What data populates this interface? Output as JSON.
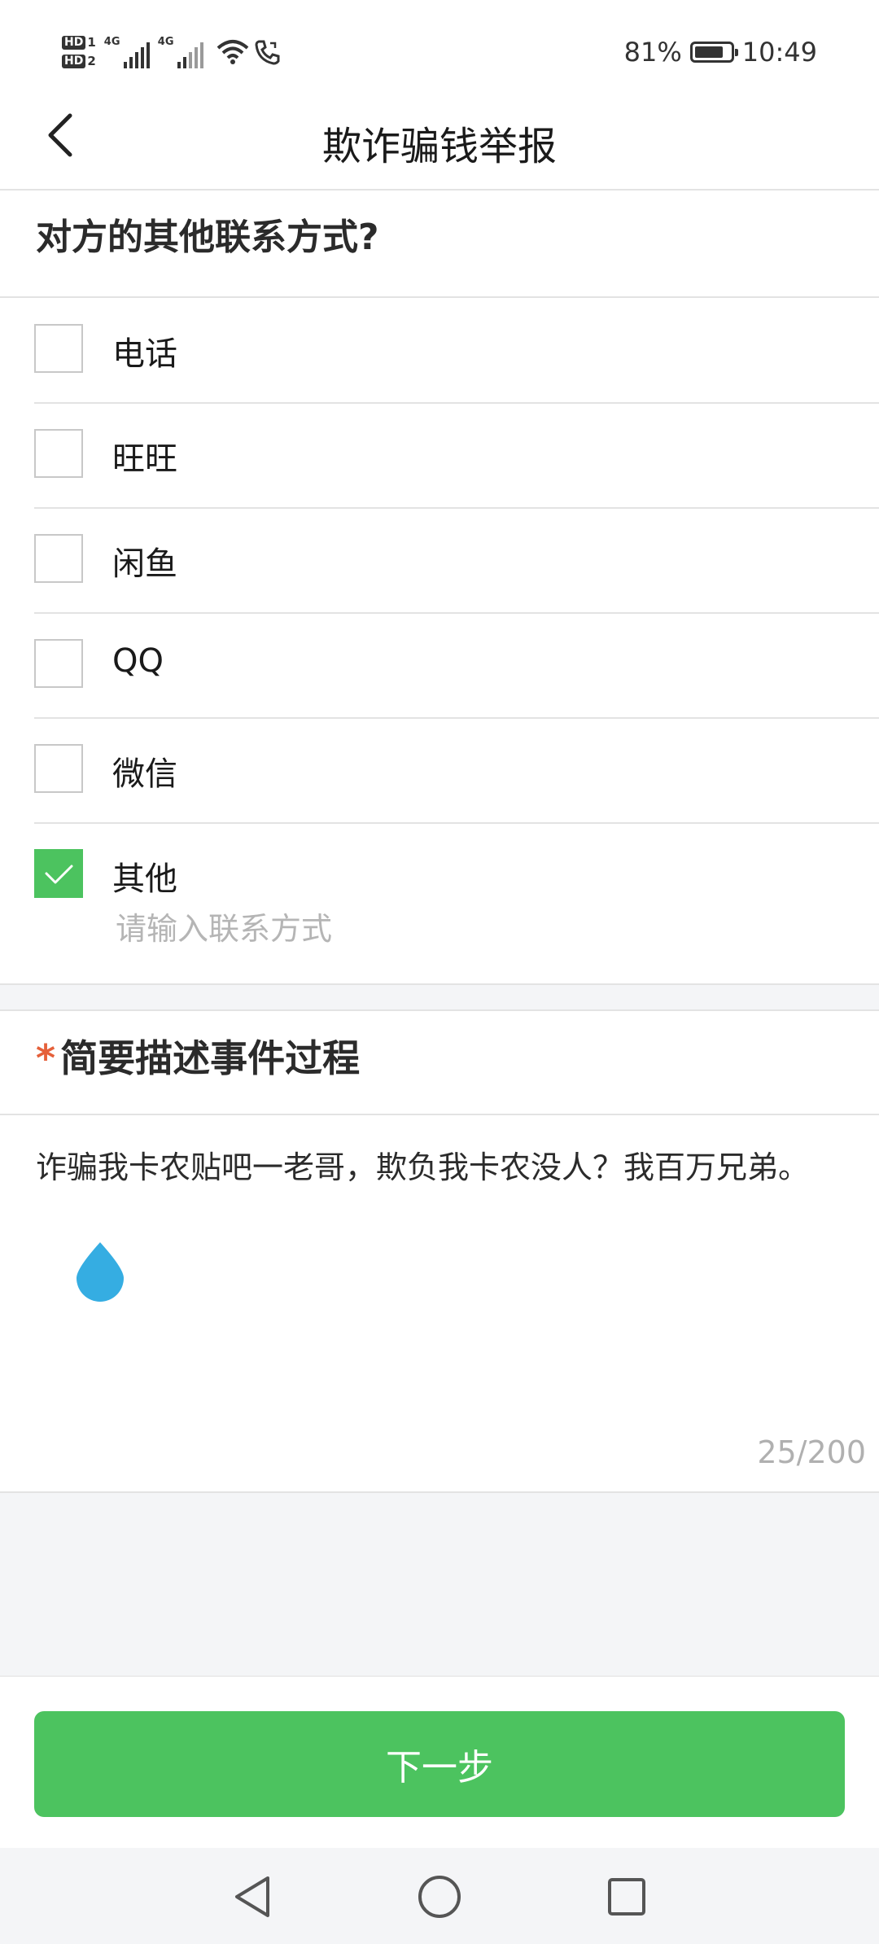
{
  "status_bar": {
    "hd1": "HD",
    "hd1_sub": "1",
    "hd2": "HD",
    "hd2_sub": "2",
    "net1": "4G",
    "net2": "4G",
    "battery_percent": "81%",
    "battery_level": 0.81,
    "time": "10:49",
    "icons": [
      "wifi-icon",
      "phone-call-icon",
      "battery-icon"
    ]
  },
  "nav": {
    "title": "欺诈骗钱举报",
    "back_icon": "chevron-left-icon"
  },
  "contact_question": {
    "title": "对方的其他联系方式?",
    "options": [
      {
        "label": "电话",
        "checked": false
      },
      {
        "label": "旺旺",
        "checked": false
      },
      {
        "label": "闲鱼",
        "checked": false
      },
      {
        "label": "QQ",
        "checked": false
      },
      {
        "label": "微信",
        "checked": false
      },
      {
        "label": "其他",
        "checked": true
      }
    ],
    "other_placeholder": "请输入联系方式"
  },
  "description": {
    "required_mark": "*",
    "title": "简要描述事件过程",
    "text": "诈骗我卡农贴吧一老哥，欺负我卡农没人？我百万兄弟。",
    "counter": "25/200"
  },
  "footer": {
    "next_label": "下一步"
  },
  "colors": {
    "accent_green": "#4cc35f",
    "required_red": "#e5603a",
    "cursor_blue": "#35ade2"
  }
}
